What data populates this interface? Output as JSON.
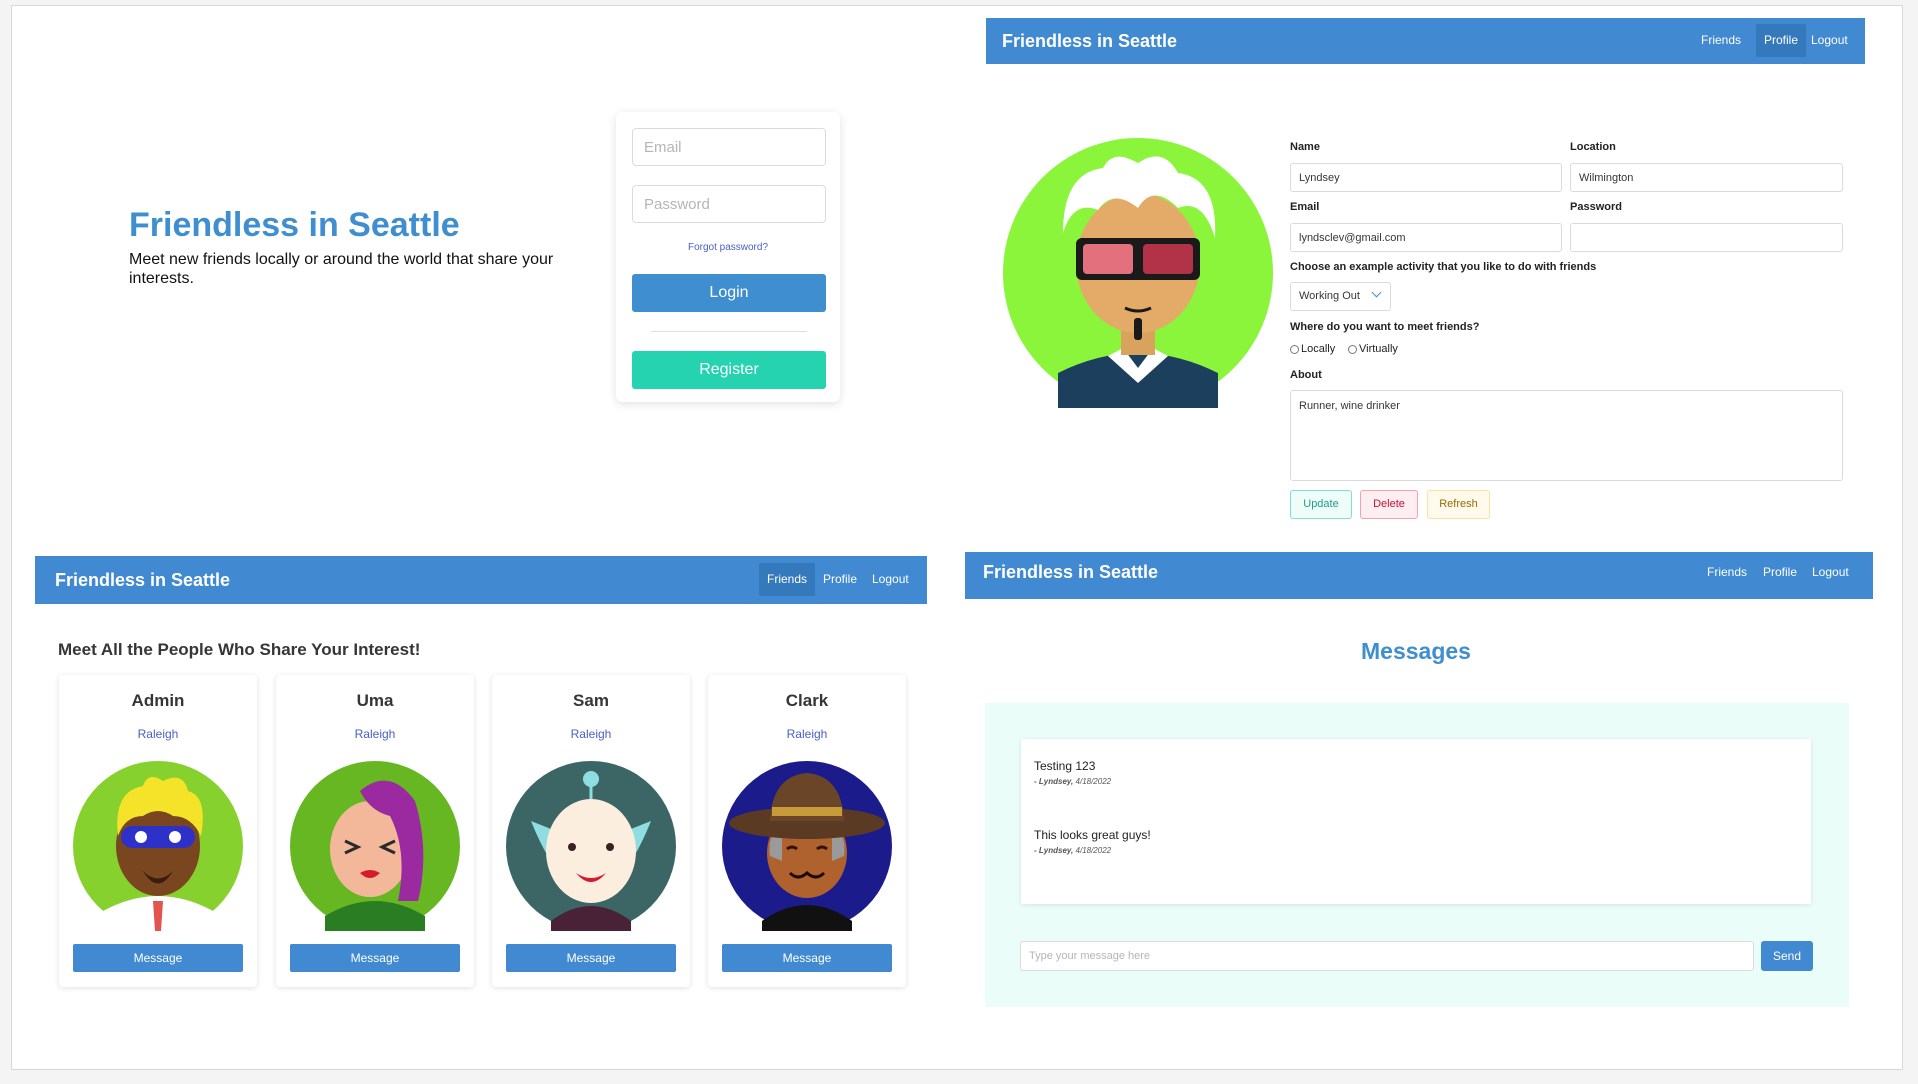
{
  "login": {
    "title": "Friendless in Seattle",
    "subtitle": "Meet new friends locally or around the world that share your interests.",
    "email_placeholder": "Email",
    "password_placeholder": "Password",
    "forgot_label": "Forgot password?",
    "login_label": "Login",
    "register_label": "Register"
  },
  "profile_nav": {
    "brand": "Friendless in Seattle",
    "items": [
      "Friends",
      "Profile",
      "Logout"
    ],
    "active": "Profile"
  },
  "profile": {
    "name_label": "Name",
    "name_value": "Lyndsey",
    "location_label": "Location",
    "location_value": "Wilmington",
    "email_label": "Email",
    "email_value": "lyndsclev@gmail.com",
    "password_label": "Password",
    "password_value": "",
    "activity_label": "Choose an example activity that you like to do with friends",
    "activity_value": "Working Out",
    "meet_label": "Where do you want to meet friends?",
    "meet_options": [
      "Locally",
      "Virtually"
    ],
    "about_label": "About",
    "about_value": "Runner, wine drinker",
    "update_label": "Update",
    "delete_label": "Delete",
    "refresh_label": "Refresh"
  },
  "friends_nav": {
    "brand": "Friendless in Seattle",
    "items": [
      "Friends",
      "Profile",
      "Logout"
    ],
    "active": "Friends"
  },
  "friends": {
    "heading": "Meet All the People Who Share Your Interest!",
    "message_label": "Message",
    "people": [
      {
        "name": "Admin",
        "city": "Raleigh"
      },
      {
        "name": "Uma",
        "city": "Raleigh"
      },
      {
        "name": "Sam",
        "city": "Raleigh"
      },
      {
        "name": "Clark",
        "city": "Raleigh"
      }
    ]
  },
  "messages_nav": {
    "brand": "Friendless in Seattle",
    "items": [
      "Friends",
      "Profile",
      "Logout"
    ],
    "active": ""
  },
  "messages": {
    "heading": "Messages",
    "list": [
      {
        "text": "Testing 123",
        "author": "- Lyndsey,",
        "date": "4/18/2022"
      },
      {
        "text": "This looks great guys!",
        "author": "- Lyndsey,",
        "date": "4/18/2022"
      }
    ],
    "input_placeholder": "Type your message here",
    "send_label": "Send"
  },
  "colors": {
    "primary": "#4189d0",
    "title_blue": "#3e8ed0",
    "register_teal": "#26d3b1",
    "messages_bg": "#eafdf9"
  },
  "icons": [
    "profile-avatar-icon",
    "admin-avatar-icon",
    "uma-avatar-icon",
    "sam-avatar-icon",
    "clark-avatar-icon"
  ]
}
